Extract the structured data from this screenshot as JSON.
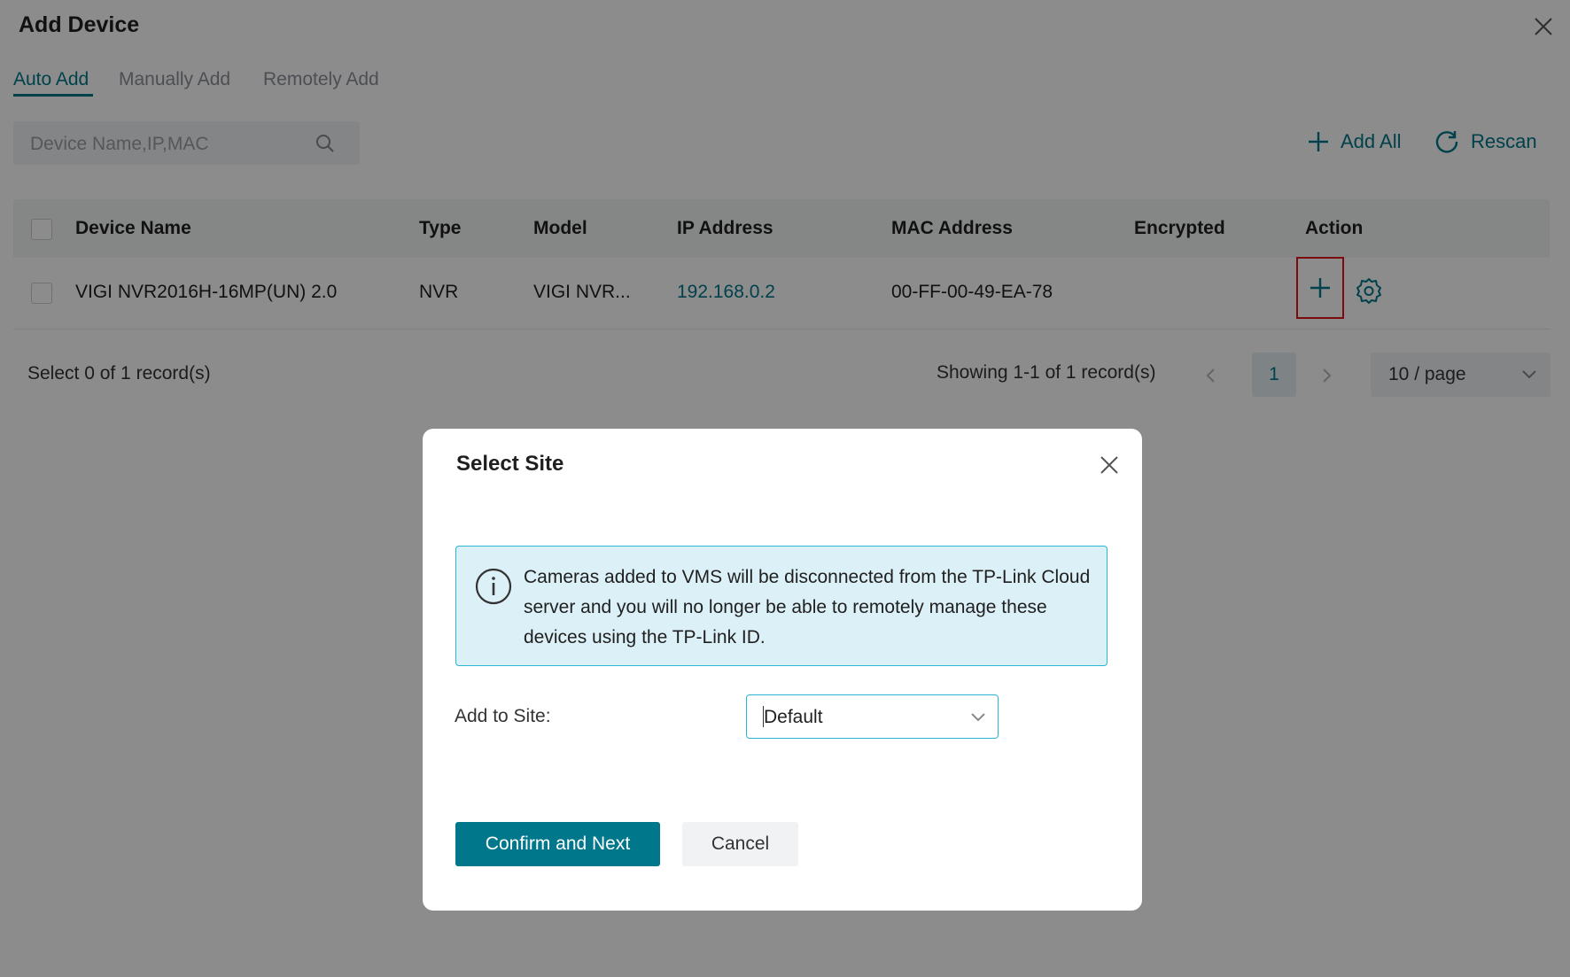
{
  "app": {
    "title": "Add Device"
  },
  "tabs": [
    {
      "label": "Auto Add",
      "active": true
    },
    {
      "label": "Manually Add",
      "active": false
    },
    {
      "label": "Remotely Add",
      "active": false
    }
  ],
  "search": {
    "placeholder": "Device Name,IP,MAC",
    "value": ""
  },
  "toolbar": {
    "add_all_label": "Add All",
    "rescan_label": "Rescan"
  },
  "table": {
    "columns": [
      "Device Name",
      "Type",
      "Model",
      "IP Address",
      "MAC Address",
      "Encrypted",
      "Action"
    ],
    "rows": [
      {
        "device_name": "VIGI NVR2016H-16MP(UN) 2.0",
        "type": "NVR",
        "model": "VIGI NVR...",
        "ip": "192.168.0.2",
        "mac": "00-FF-00-49-EA-78",
        "encrypted": ""
      }
    ]
  },
  "footer": {
    "selected": "Select 0 of 1 record(s)",
    "showing": "Showing 1-1 of 1 record(s)",
    "current_page": "1",
    "page_size": "10 / page"
  },
  "dialog": {
    "title": "Select Site",
    "info_text": "Cameras added to VMS will be disconnected from the TP-Link Cloud server and you will no longer be able to remotely manage these devices using the TP-Link ID.",
    "site_label": "Add to Site:",
    "site_value": "Default",
    "confirm_label": "Confirm and Next",
    "cancel_label": "Cancel"
  },
  "colors": {
    "accent": "#00778b",
    "info_bg": "#dcf0f8",
    "info_border": "#2ab5d2",
    "highlight": "#e0151d"
  },
  "icons": {
    "close": "close-icon",
    "search": "search-icon",
    "add": "plus-icon",
    "rescan": "refresh-icon",
    "settings": "gear-icon",
    "info": "info-icon"
  }
}
